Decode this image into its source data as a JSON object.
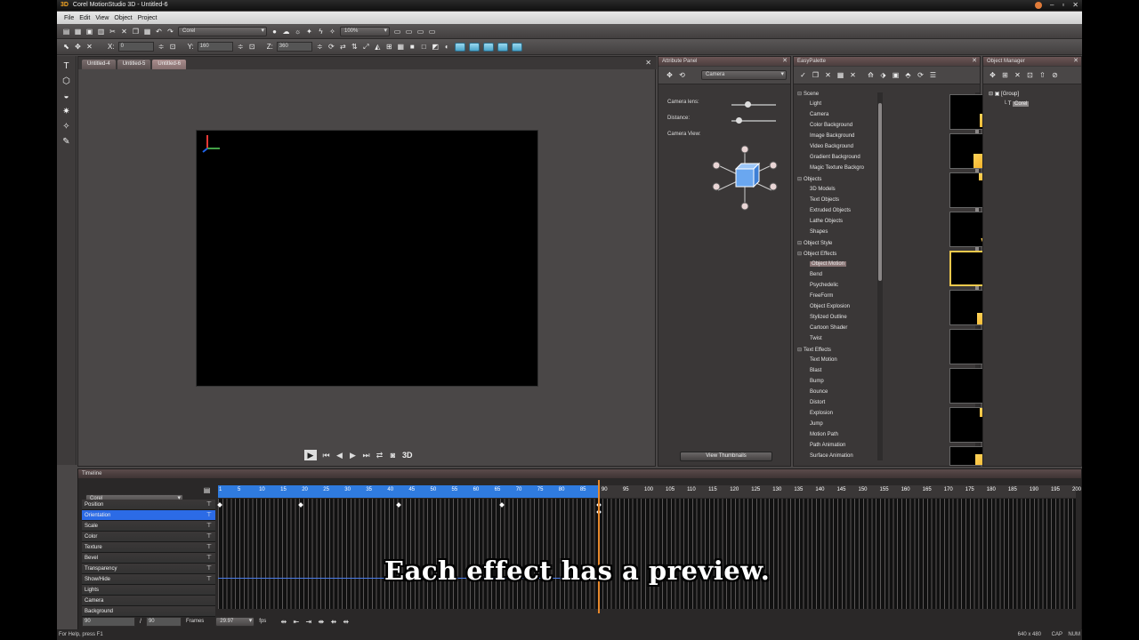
{
  "window": {
    "title": "Corel MotionStudio 3D - Untitled-6",
    "logo": "3D"
  },
  "menu": [
    "File",
    "Edit",
    "View",
    "Object",
    "Project"
  ],
  "toolbar": {
    "preset_combo": "Corel",
    "zoom_combo": "100%"
  },
  "coords": {
    "x_label": "X:",
    "x_value": "0",
    "y_label": "Y:",
    "y_value": "160",
    "z_label": "Z:",
    "z_value": "360"
  },
  "viewport": {
    "tabs": [
      "Untitled-4",
      "Untitled-5",
      "Untitled-6"
    ],
    "mode_label": "3D"
  },
  "attribute_panel": {
    "title": "Attribute Panel",
    "combo": "Camera",
    "camera_lens_label": "Camera lens:",
    "camera_lens_level": 0.3,
    "distance_label": "Distance:",
    "distance_level": 0.1,
    "camera_view_label": "Camera View:",
    "view_thumbnails": "View Thumbnails"
  },
  "easy_palette": {
    "title": "EasyPalette",
    "tree": [
      {
        "label": "Scene",
        "cat": true
      },
      {
        "label": "Light"
      },
      {
        "label": "Camera"
      },
      {
        "label": "Color Background"
      },
      {
        "label": "Image Background"
      },
      {
        "label": "Video Background"
      },
      {
        "label": "Gradient Background"
      },
      {
        "label": "Magic Texture Backgro"
      },
      {
        "label": "Objects",
        "cat": true
      },
      {
        "label": "3D Models"
      },
      {
        "label": "Text Objects"
      },
      {
        "label": "Extruded Objects"
      },
      {
        "label": "Lathe Objects"
      },
      {
        "label": "Shapes"
      },
      {
        "label": "Object Style",
        "cat": true
      },
      {
        "label": "Object Effects",
        "cat": true
      },
      {
        "label": "Object Motion",
        "sel": true
      },
      {
        "label": "Bend"
      },
      {
        "label": "Psychedelic"
      },
      {
        "label": "FreeForm"
      },
      {
        "label": "Object Explosion"
      },
      {
        "label": "Stylized Outline"
      },
      {
        "label": "Cartoon Shader"
      },
      {
        "label": "Twist"
      },
      {
        "label": "Text Effects",
        "cat": true
      },
      {
        "label": "Text Motion"
      },
      {
        "label": "Blast"
      },
      {
        "label": "Bump"
      },
      {
        "label": "Bounce"
      },
      {
        "label": "Distort"
      },
      {
        "label": "Explosion"
      },
      {
        "label": "Jump"
      },
      {
        "label": "Motion Path"
      },
      {
        "label": "Path Animation"
      },
      {
        "label": "Surface Animation"
      }
    ]
  },
  "object_manager": {
    "title": "Object Manager",
    "group": "[Group]",
    "item": "Corel"
  },
  "timeline": {
    "title": "Timeline",
    "combo": "Corel",
    "tracks": [
      "Position",
      "Orientation",
      "Scale",
      "Color",
      "Texture",
      "Bevel",
      "Transparency",
      "Show/Hide",
      "Lights",
      "Camera",
      "Background"
    ],
    "ticks": [
      "1",
      "5",
      "10",
      "15",
      "20",
      "25",
      "30",
      "35",
      "40",
      "45",
      "50",
      "55",
      "60",
      "65",
      "70",
      "75",
      "80",
      "85",
      "90",
      "95",
      "100",
      "105",
      "110",
      "115",
      "120",
      "125",
      "130",
      "135",
      "140",
      "145",
      "150",
      "155",
      "160",
      "165",
      "170",
      "175",
      "180",
      "185",
      "190",
      "195",
      "200"
    ],
    "current_frame": "90",
    "total_frames": "90",
    "frames_label": "Frames",
    "fps": "29.97",
    "fps_label": "fps"
  },
  "status": {
    "help": "For Help, press F1",
    "size": "640 x 480",
    "caps": "CAP",
    "num": "NUM"
  },
  "subtitle": "Each effect has a preview."
}
